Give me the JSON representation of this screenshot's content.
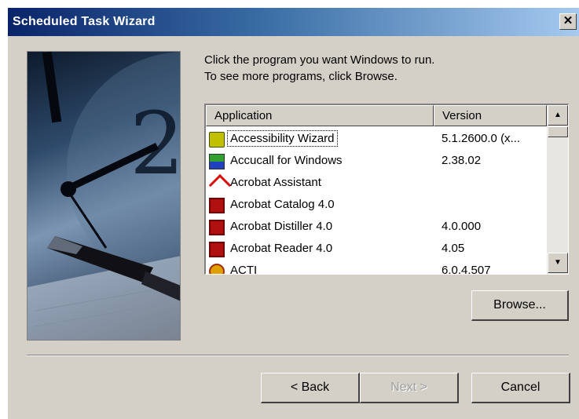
{
  "window": {
    "title": "Scheduled Task Wizard",
    "close_glyph": "✕"
  },
  "instructions": {
    "line1": "Click the program you want Windows to run.",
    "line2": "To see more programs, click Browse."
  },
  "table": {
    "columns": [
      "Application",
      "Version"
    ],
    "rows": [
      {
        "name": "",
        "version": "",
        "icon": "app-icon"
      },
      {
        "name": "Accessibility Wizard",
        "version": "5.1.2600.0 (x...",
        "icon": "accessibility-icon"
      },
      {
        "name": "Accucall for Windows",
        "version": "2.38.02",
        "icon": "accucall-icon"
      },
      {
        "name": "Acrobat Assistant",
        "version": "",
        "icon": "acrobat-assistant-icon"
      },
      {
        "name": "Acrobat Catalog 4.0",
        "version": "",
        "icon": "acrobat-catalog-icon"
      },
      {
        "name": "Acrobat Distiller 4.0",
        "version": "4.0.000",
        "icon": "acrobat-distiller-icon"
      },
      {
        "name": "Acrobat Reader 4.0",
        "version": "4.05",
        "icon": "acrobat-reader-icon"
      },
      {
        "name": "ACTI",
        "version": "6.0.4.507",
        "icon": "acti-icon"
      }
    ],
    "focused_row": "Accessibility Wizard",
    "scroll_up_glyph": "▲",
    "scroll_down_glyph": "▼"
  },
  "buttons": {
    "browse": "Browse...",
    "back": "< Back",
    "next": "Next >",
    "cancel": "Cancel"
  },
  "colors": {
    "titlebar_start": "#0a246a",
    "titlebar_end": "#a6caf0",
    "face": "#d4d0c8"
  }
}
